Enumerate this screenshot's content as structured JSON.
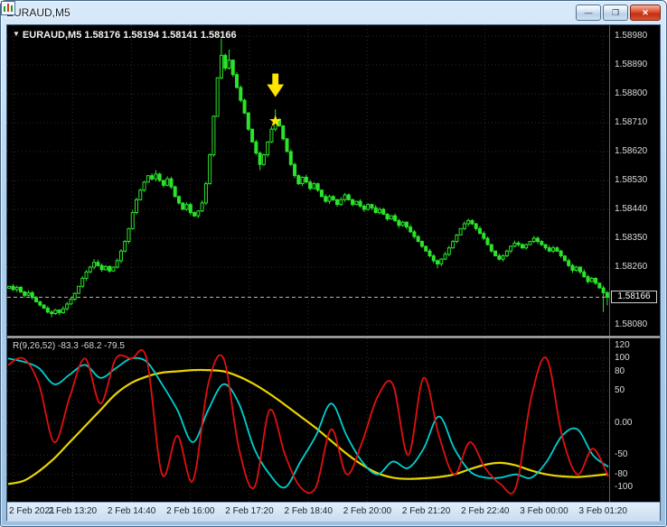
{
  "window": {
    "title": "EURAUD,M5",
    "controls": {
      "minimize": "—",
      "maximize": "❐",
      "close": "✕"
    }
  },
  "price_pane": {
    "info_marker": "▼",
    "info_label": "EURAUD,M5 1.58176 1.58194 1.58141 1.58166",
    "axis_ticks": [
      "1.58980",
      "1.58890",
      "1.58800",
      "1.58710",
      "1.58620",
      "1.58530",
      "1.58440",
      "1.58350",
      "1.58260",
      "1.58080"
    ],
    "current_price": "1.58166"
  },
  "indicator_pane": {
    "label": "R(9,26,52) -83.3 -68.2 -79.5",
    "axis_ticks": [
      "120",
      "100",
      "80",
      "50",
      "0.00",
      "-50",
      "-80",
      "-100"
    ]
  },
  "time_axis": {
    "labels": [
      "2 Feb 2021",
      "2 Feb 13:20",
      "2 Feb 14:40",
      "2 Feb 16:00",
      "2 Feb 17:20",
      "2 Feb 18:40",
      "2 Feb 20:00",
      "2 Feb 21:20",
      "2 Feb 22:40",
      "3 Feb 00:00",
      "3 Feb 01:20"
    ]
  },
  "colors": {
    "background": "#000000",
    "grid": "#2d2d2d",
    "candle": "#2be32b",
    "price_line": "#b8b8b8",
    "annotation": "#ffe400"
  },
  "chart_data": {
    "type": "candlestick",
    "symbol": "EURAUD",
    "timeframe": "M5",
    "title": "EURAUD,M5",
    "last_ohlc": {
      "open": 1.58176,
      "high": 1.58194,
      "low": 1.58141,
      "close": 1.58166
    },
    "current_price": 1.58166,
    "y_axis": {
      "range": [
        1.5808,
        1.5898
      ],
      "ticks": [
        1.5898,
        1.5889,
        1.588,
        1.5871,
        1.5862,
        1.5853,
        1.5844,
        1.5835,
        1.5826,
        1.5808
      ]
    },
    "x_axis": {
      "labels": [
        "2 Feb 2021",
        "2 Feb 13:20",
        "2 Feb 14:40",
        "2 Feb 16:00",
        "2 Feb 17:20",
        "2 Feb 18:40",
        "2 Feb 20:00",
        "2 Feb 21:20",
        "2 Feb 22:40",
        "3 Feb 00:00",
        "3 Feb 01:20"
      ]
    },
    "candle_open_rule": "previous_close",
    "wick": 7e-05,
    "candles_closes": [
      1.582,
      1.5819,
      1.58197,
      1.58183,
      1.58172,
      1.5818,
      1.58165,
      1.58152,
      1.58142,
      1.58132,
      1.5812,
      1.58115,
      1.58126,
      1.58118,
      1.5813,
      1.58145,
      1.5816,
      1.58178,
      1.582,
      1.58225,
      1.58245,
      1.5826,
      1.58275,
      1.58265,
      1.58252,
      1.58262,
      1.58248,
      1.5826,
      1.5828,
      1.5831,
      1.5834,
      1.5838,
      1.5843,
      1.5847,
      1.585,
      1.58525,
      1.58545,
      1.58535,
      1.5855,
      1.5853,
      1.58515,
      1.58535,
      1.5851,
      1.5848,
      1.5846,
      1.5844,
      1.58455,
      1.5843,
      1.5842,
      1.58435,
      1.5846,
      1.5852,
      1.5861,
      1.5873,
      1.5885,
      1.5892,
      1.5888,
      1.58905,
      1.5886,
      1.5882,
      1.5878,
      1.5874,
      1.5869,
      1.5865,
      1.58615,
      1.5858,
      1.5861,
      1.5865,
      1.5869,
      1.5872,
      1.587,
      1.5866,
      1.5862,
      1.5858,
      1.58545,
      1.5852,
      1.5854,
      1.58525,
      1.58505,
      1.5852,
      1.585,
      1.5848,
      1.58465,
      1.5848,
      1.5847,
      1.58455,
      1.5847,
      1.58485,
      1.5847,
      1.58455,
      1.58465,
      1.5845,
      1.5844,
      1.58455,
      1.58445,
      1.5843,
      1.5844,
      1.58425,
      1.5841,
      1.5842,
      1.58405,
      1.5839,
      1.584,
      1.58385,
      1.5837,
      1.58355,
      1.5834,
      1.58325,
      1.5831,
      1.58295,
      1.5828,
      1.5827,
      1.58285,
      1.583,
      1.5832,
      1.5834,
      1.5836,
      1.5838,
      1.58395,
      1.58405,
      1.58395,
      1.5838,
      1.58365,
      1.5835,
      1.5833,
      1.5831,
      1.58295,
      1.58285,
      1.58295,
      1.5831,
      1.58325,
      1.58335,
      1.5833,
      1.5832,
      1.5833,
      1.5834,
      1.5835,
      1.5834,
      1.5833,
      1.5832,
      1.5831,
      1.5832,
      1.5831,
      1.58295,
      1.5828,
      1.58265,
      1.5825,
      1.5826,
      1.58245,
      1.5823,
      1.58215,
      1.58225,
      1.5821,
      1.58195,
      1.5818,
      1.58166
    ],
    "extremes": {
      "high": {
        "22": 1.58285,
        "38": 1.58563,
        "55": 1.58972,
        "57": 1.58938,
        "69": 1.58752
      },
      "low": {
        "11": 1.58103,
        "65": 1.58562,
        "111": 1.58256,
        "154": 1.5812,
        "155": 1.58141
      }
    },
    "annotations": [
      {
        "type": "arrow-down",
        "color": "#ffe400",
        "candle": 69,
        "price": 1.5879
      },
      {
        "type": "star",
        "color": "#ffe400",
        "candle": 69,
        "price": 1.58715
      }
    ],
    "oscillator": {
      "name": "R(9,26,52)",
      "current_values": [
        -83.3,
        -68.2,
        -79.5
      ],
      "range": [
        -100,
        120
      ],
      "axis_ticks": [
        120,
        100,
        80,
        50,
        0,
        -50,
        -80,
        -100
      ],
      "levels": [
        100,
        80,
        50,
        0,
        -50,
        -80,
        -100
      ],
      "series": [
        {
          "name": "fast-red",
          "color": "#e01010",
          "width": 1.8,
          "values": [
            90,
            100,
            60,
            -30,
            40,
            100,
            30,
            100,
            100,
            100,
            -80,
            -20,
            -90,
            60,
            100,
            -40,
            -100,
            20,
            -50,
            -100,
            -100,
            -10,
            -80,
            -30,
            40,
            60,
            -50,
            70,
            -20,
            -80,
            -30,
            -70,
            -95,
            -100,
            40,
            100,
            -20,
            -80,
            -40,
            -83.3
          ]
        },
        {
          "name": "medium-aqua",
          "color": "#00cfcf",
          "width": 1.8,
          "values": [
            100,
            95,
            85,
            60,
            75,
            90,
            70,
            85,
            100,
            95,
            60,
            20,
            -30,
            20,
            60,
            30,
            -40,
            -80,
            -100,
            -60,
            -20,
            30,
            -20,
            -60,
            -80,
            -60,
            -70,
            -40,
            10,
            -40,
            -75,
            -85,
            -85,
            -80,
            -85,
            -60,
            -20,
            -10,
            -50,
            -68.2
          ]
        },
        {
          "name": "slow-yellow",
          "color": "#e8d400",
          "width": 2.2,
          "values": [
            -95,
            -90,
            -75,
            -55,
            -30,
            -5,
            20,
            45,
            62,
            72,
            78,
            80,
            82,
            82,
            80,
            72,
            60,
            45,
            28,
            10,
            -8,
            -28,
            -48,
            -65,
            -78,
            -85,
            -87,
            -86,
            -84,
            -80,
            -72,
            -65,
            -62,
            -66,
            -74,
            -80,
            -83,
            -84,
            -82,
            -79.5
          ]
        }
      ]
    }
  }
}
